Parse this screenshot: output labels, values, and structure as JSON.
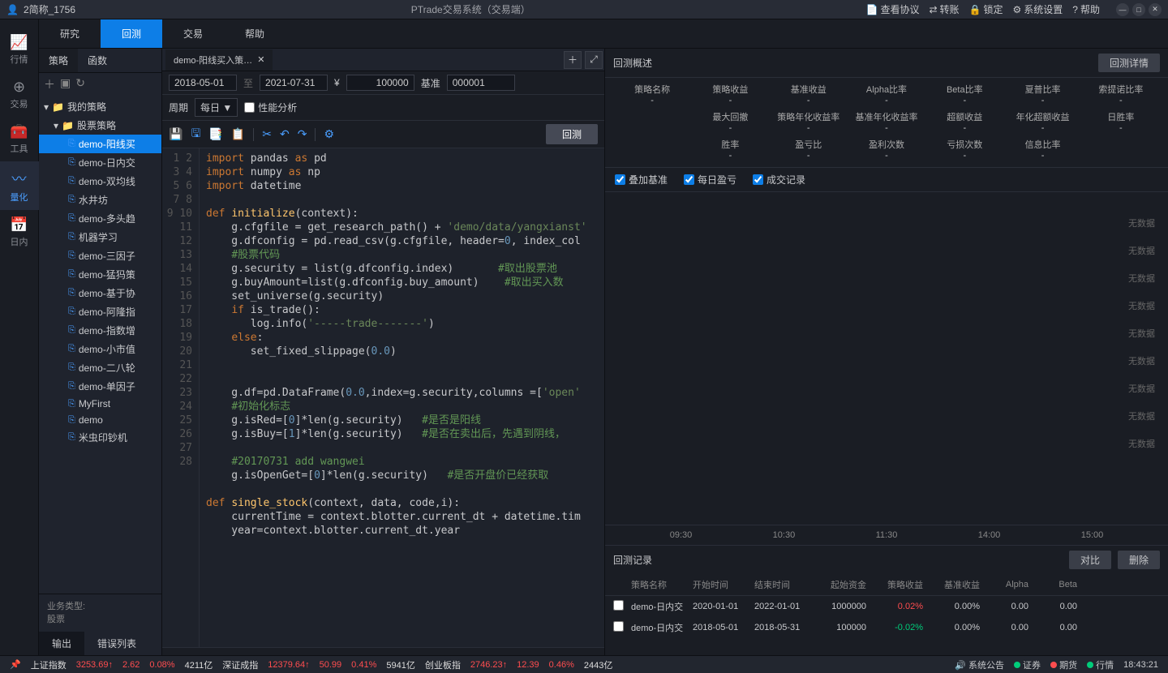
{
  "titlebar": {
    "account_icon": "👤",
    "account": "2简称_1756",
    "title": "PTrade交易系统（交易端）",
    "view_protocol": "查看协议",
    "transfer": "转账",
    "lock": "锁定",
    "settings": "系统设置",
    "help": "帮助"
  },
  "rail": [
    {
      "icon": "📈",
      "label": "行情"
    },
    {
      "icon": "⊕",
      "label": "交易"
    },
    {
      "icon": "🧰",
      "label": "工具"
    },
    {
      "icon": "〰",
      "label": "量化",
      "active": true
    },
    {
      "icon": "📅",
      "label": "日内"
    }
  ],
  "topnav": [
    {
      "label": "研究"
    },
    {
      "label": "回测",
      "active": true
    },
    {
      "label": "交易"
    },
    {
      "label": "帮助"
    }
  ],
  "left_tabs": [
    {
      "label": "策略",
      "active": true
    },
    {
      "label": "函数"
    }
  ],
  "tree": {
    "root": "我的策略",
    "sub": "股票策略",
    "items": [
      {
        "label": "demo-阳线买",
        "selected": true
      },
      {
        "label": "demo-日内交"
      },
      {
        "label": "demo-双均线"
      },
      {
        "label": "水井坊"
      },
      {
        "label": "demo-多头趋"
      },
      {
        "label": "机器学习"
      },
      {
        "label": "demo-三因子"
      },
      {
        "label": "demo-猛犸策"
      },
      {
        "label": "demo-基于协"
      },
      {
        "label": "demo-阿隆指"
      },
      {
        "label": "demo-指数增"
      },
      {
        "label": "demo-小市值"
      },
      {
        "label": "demo-二八轮"
      },
      {
        "label": "demo-单因子"
      },
      {
        "label": "MyFirst"
      },
      {
        "label": "demo"
      },
      {
        "label": "米虫印钞机"
      }
    ]
  },
  "biz": {
    "label": "业务类型:",
    "value": "股票"
  },
  "editor_tab": "demo-阳线买入策…",
  "params": {
    "start": "2018-05-01",
    "sep": "至",
    "end": "2021-07-31",
    "currency": "¥",
    "amount": "100000",
    "bench_lbl": "基准",
    "bench": "000001",
    "period_lbl": "周期",
    "period": "每日 ▼",
    "perf": "性能分析"
  },
  "backtest_btn": "回测",
  "code_lines": [
    1,
    2,
    3,
    4,
    5,
    6,
    7,
    8,
    9,
    10,
    11,
    12,
    13,
    14,
    15,
    16,
    17,
    18,
    19,
    20,
    21,
    22,
    23,
    24,
    25,
    26,
    27,
    28
  ],
  "out_tabs": {
    "output": "输出",
    "errors": "错误列表"
  },
  "overview": {
    "title": "回测概述",
    "detail": "回测详情"
  },
  "metrics": [
    "策略名称",
    "策略收益",
    "基准收益",
    "Alpha比率",
    "Beta比率",
    "夏普比率",
    "索提诺比率",
    "",
    "最大回撤",
    "策略年化收益率",
    "基准年化收益率",
    "超额收益",
    "年化超额收益",
    "日胜率",
    "",
    "胜率",
    "盈亏比",
    "盈利次数",
    "亏损次数",
    "信息比率",
    ""
  ],
  "chk": {
    "overlay": "叠加基准",
    "daily": "每日盈亏",
    "trades": "成交记录"
  },
  "nodata": "无数据",
  "xticks": [
    "09:30",
    "10:30",
    "11:30",
    "14:00",
    "15:00"
  ],
  "records": {
    "title": "回测记录",
    "compare": "对比",
    "delete": "删除",
    "cols": [
      "",
      "策略名称",
      "开始时间",
      "结束时间",
      "起始资金",
      "策略收益",
      "基准收益",
      "Alpha",
      "Beta"
    ],
    "rows": [
      {
        "name": "demo-日内交",
        "start": "2020-01-01",
        "end": "2022-01-01",
        "cap": "1000000",
        "sret": "0.02%",
        "sret_cls": "pos",
        "bret": "0.00%",
        "alpha": "0.00",
        "beta": "0.00"
      },
      {
        "name": "demo-日内交",
        "start": "2018-05-01",
        "end": "2018-05-31",
        "cap": "100000",
        "sret": "-0.02%",
        "sret_cls": "neg",
        "bret": "0.00%",
        "alpha": "0.00",
        "beta": "0.00"
      }
    ]
  },
  "status": {
    "idx": [
      {
        "name": "上证指数",
        "val": "3253.69",
        "chg": "2.62",
        "pct": "0.08%",
        "vol": "4211亿"
      },
      {
        "name": "深证成指",
        "val": "12379.64",
        "chg": "50.99",
        "pct": "0.41%",
        "vol": "5941亿"
      },
      {
        "name": "创业板指",
        "val": "2746.23",
        "chg": "12.39",
        "pct": "0.46%",
        "vol": "2443亿"
      }
    ],
    "announce": "系统公告",
    "stock": "证券",
    "future": "期货",
    "quote": "行情",
    "time": "18:43:21"
  }
}
